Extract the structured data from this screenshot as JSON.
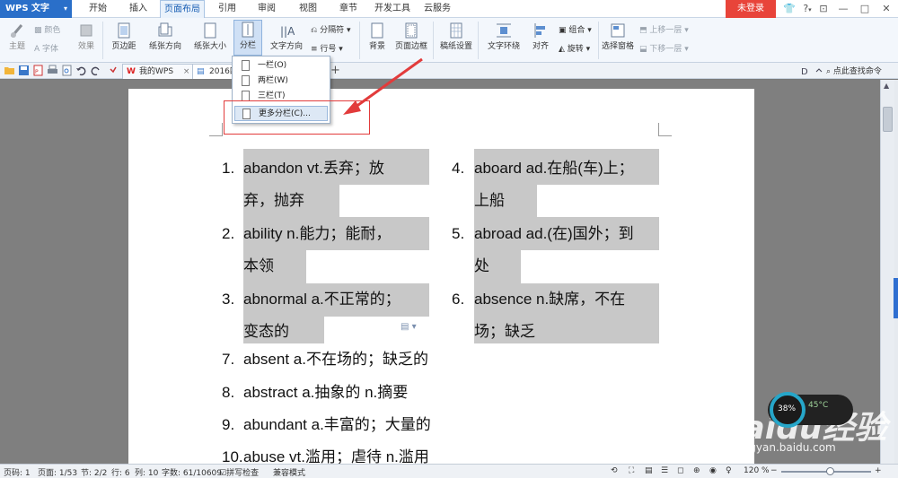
{
  "app": {
    "title": "WPS 文字",
    "menu_arrow": "▾"
  },
  "menu": {
    "tabs": [
      "开始",
      "插入",
      "页面布局",
      "引用",
      "审阅",
      "视图",
      "章节",
      "开发工具",
      "云服务"
    ],
    "active_index": 2,
    "login": "未登录",
    "controls": [
      "tshirt-icon",
      "help-icon",
      "restore-icon",
      "minimize-icon",
      "maximize-icon",
      "close-icon"
    ],
    "control_glyphs": [
      "👕",
      "?",
      "⊡",
      "—",
      "□",
      "✕"
    ],
    "help_arrow": "▾"
  },
  "ribbon": {
    "theme_group": {
      "theme": "主题",
      "color": "颜色",
      "font": "字体",
      "effect": "效果"
    },
    "buttons": {
      "margin": "页边距",
      "orientation": "纸张方向",
      "size": "纸张大小",
      "columns": "分栏",
      "text_direction": "文字方向",
      "separator": "分隔符",
      "line_number": "行号",
      "background": "背景",
      "page_border": "页面边框",
      "manuscript": "稿纸设置",
      "text_wrap": "文字环绕",
      "align": "对齐",
      "group": "组合",
      "rotate": "旋转",
      "selection_pane": "选择窗格",
      "bring_forward": "上移一层",
      "send_backward": "下移一层"
    }
  },
  "quickbar": {
    "tabs": [
      {
        "label": "我的WPS",
        "close": "×"
      },
      {
        "label": "2016四",
        "close": ""
      }
    ],
    "new_tab": "+",
    "find": "点此查找命令"
  },
  "columns_menu": {
    "items": [
      "一栏(O)",
      "两栏(W)",
      "三栏(T)",
      "更多分栏(C)..."
    ],
    "hover_index": 3
  },
  "document": {
    "left_column": [
      {
        "num": "1.",
        "lines": [
          "abandon      vt.丢弃；放",
          "弃，抛弃"
        ]
      },
      {
        "num": "2.",
        "lines": [
          "ability     n.能力；能耐，",
          "本领"
        ]
      },
      {
        "num": "3.",
        "lines": [
          "abnormal      a.不正常的；",
          "变态的"
        ]
      }
    ],
    "right_column": [
      {
        "num": "4.",
        "lines": [
          "aboard      ad.在船(车)上；",
          "上船"
        ]
      },
      {
        "num": "5.",
        "lines": [
          "abroad      ad.(在)国外；到",
          "处"
        ]
      },
      {
        "num": "6.",
        "lines": [
          "absence      n.缺席，不在",
          "场；缺乏"
        ]
      }
    ],
    "single_column": [
      {
        "num": "7.",
        "text": "absent     a.不在场的；缺乏的"
      },
      {
        "num": "8.",
        "text": "abstract     a.抽象的      n.摘要"
      },
      {
        "num": "9.",
        "text": "abundant     a.丰富的；大量的"
      },
      {
        "num": "10.",
        "text": "  abuse     vt.滥用；虐待     n.滥用"
      }
    ],
    "paste_icon": "paste-options-icon"
  },
  "status": {
    "page_num": "页码: 1",
    "page": "页面: 1/53",
    "section": "节: 2/2",
    "row": "行: 6",
    "col": "列: 10",
    "words": "字数: 61/10609",
    "spell": "拼写检查",
    "compat": "兼容模式",
    "zoom": "120 %",
    "zoom_minus": "−",
    "zoom_plus": "+"
  },
  "watermark": {
    "brand": "Baidu经验",
    "sub": "jingyan.baidu.com",
    "badge_pct": "38%",
    "badge_temp": "45°C"
  },
  "colors": {
    "accent": "#2a6fc9",
    "login_red": "#e8443a",
    "highlight_gray": "#c8c8c8",
    "callout_red": "#e23b3b"
  }
}
